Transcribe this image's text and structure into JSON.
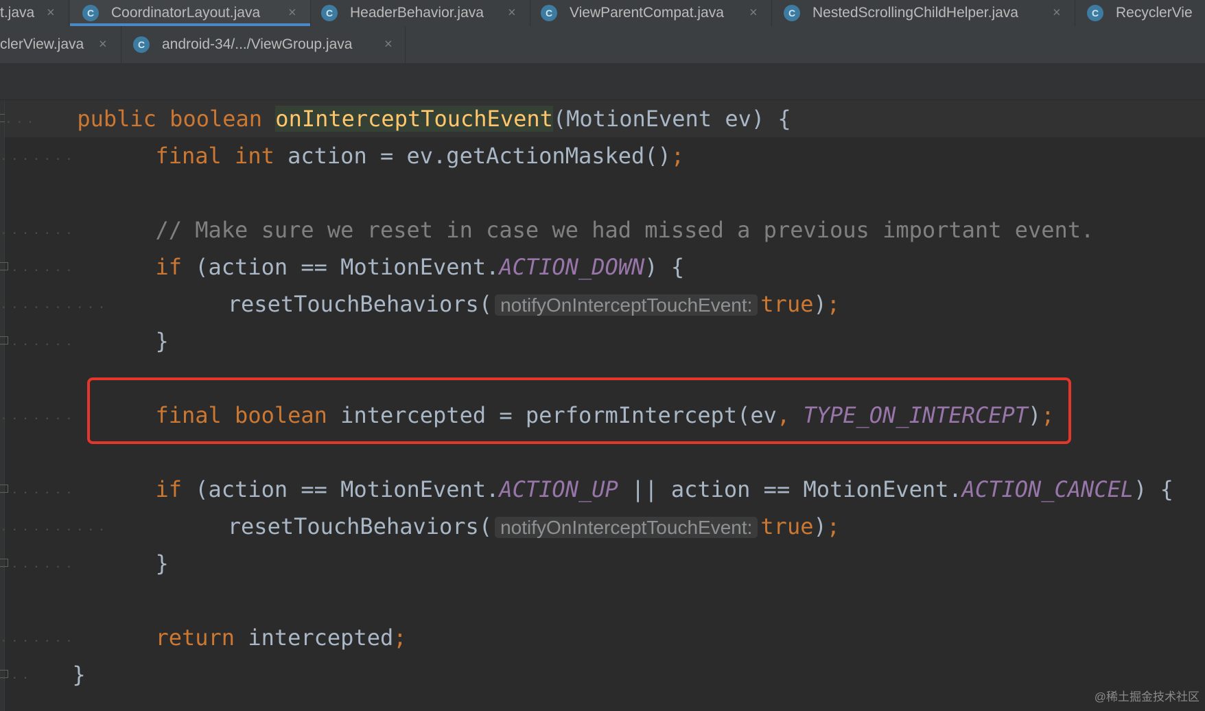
{
  "tabs_row1": [
    {
      "label": "t.java",
      "icon": "none",
      "active": false
    },
    {
      "label": "CoordinatorLayout.java",
      "icon": "class-icon",
      "active": true
    },
    {
      "label": "HeaderBehavior.java",
      "icon": "abstract-class-icon",
      "active": false
    },
    {
      "label": "ViewParentCompat.java",
      "icon": "class-icon",
      "active": false
    },
    {
      "label": "NestedScrollingChildHelper.java",
      "icon": "class-icon",
      "active": false
    },
    {
      "label": "RecyclerVie",
      "icon": "class-icon",
      "active": false
    }
  ],
  "tabs_row2": [
    {
      "label": "clerView.java",
      "icon": "none",
      "active": false
    },
    {
      "label": "android-34/.../ViewGroup.java",
      "icon": "abstract-class-icon",
      "active": false
    }
  ],
  "code": {
    "l1": {
      "k1": "public",
      "k2": "boolean",
      "fn": "onInterceptTouchEvent",
      "rest": "(MotionEvent ev) {"
    },
    "l2": {
      "k1": "final",
      "k2": "int",
      "rest": " action = ev.getActionMasked()",
      "semi": ";"
    },
    "l4": {
      "comment": "// Make sure we reset in case we had missed a previous important event."
    },
    "l5": {
      "k1": "if",
      "a": " (action == MotionEvent.",
      "c1": "ACTION_DOWN",
      "b": ") {"
    },
    "l6": {
      "call": "resetTouchBehaviors(",
      "hint": "notifyOnInterceptTouchEvent:",
      "val": "true",
      "end": ")",
      "semi": ";"
    },
    "l7": {
      "brace": "}"
    },
    "l9": {
      "k1": "final",
      "k2": "boolean",
      "a": " intercepted = performIntercept(ev",
      "comma": ",",
      "c1": "TYPE_ON_INTERCEPT",
      "b": ")",
      "semi": ";"
    },
    "l11": {
      "k1": "if",
      "a": " (action == MotionEvent.",
      "c1": "ACTION_UP",
      "b": " || action == MotionEvent.",
      "c2": "ACTION_CANCEL",
      "d": ") {"
    },
    "l12": {
      "call": "resetTouchBehaviors(",
      "hint": "notifyOnInterceptTouchEvent:",
      "val": "true",
      "end": ")",
      "semi": ";"
    },
    "l13": {
      "brace": "}"
    },
    "l15": {
      "k1": "return",
      "a": " intercepted",
      "semi": ";"
    },
    "l16": {
      "brace": "}"
    }
  },
  "watermark": "@稀土掘金技术社区",
  "colors": {
    "keyword": "#cc7832",
    "method": "#ffc66d",
    "constant": "#9876aa",
    "comment": "#808080",
    "highlight_box": "#e5362b",
    "active_tab_underline": "#4a88c7"
  }
}
